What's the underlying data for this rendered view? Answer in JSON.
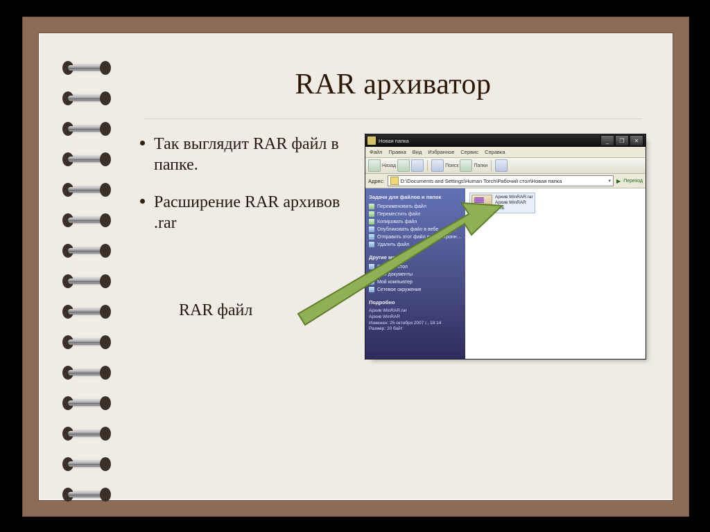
{
  "slide": {
    "title": "RAR архиватор",
    "bullets": [
      "Так выглядит RAR файл в папке.",
      "Расширение RAR архивов .rar"
    ],
    "caption": "RAR файл"
  },
  "window": {
    "title": "Новая папка",
    "controls": {
      "min": "_",
      "max": "❐",
      "close": "✕"
    },
    "menu": [
      "Файл",
      "Правка",
      "Вид",
      "Избранное",
      "Сервис",
      "Справка"
    ],
    "toolbar": {
      "back": "Назад",
      "search": "Поиск",
      "folders": "Папки"
    },
    "address": {
      "label": "Адрес:",
      "path": "D:\\Documents and Settings\\Human Torch\\Рабочий стол\\Новая папка",
      "go": "Переход"
    },
    "pane": {
      "tasks_header": "Задачи для файлов и папок",
      "tasks": [
        "Переименовать файл",
        "Переместить файл",
        "Копировать файл",
        "Опубликовать файл в вебе",
        "Отправить этот файл по электронной почте",
        "Удалить файл"
      ],
      "places_header": "Другие места",
      "places": [
        "Рабочий стол",
        "Мои документы",
        "Мой компьютер",
        "Сетевое окружение"
      ],
      "details_header": "Подробно",
      "details": {
        "name": "Архив WinRAR.rar",
        "type": "Архив WinRAR",
        "modified": "Изменен: 25 октября 2007 г., 18:14",
        "size": "Размер: 20 байт"
      }
    },
    "file": {
      "name": "Архив WinRAR.rar",
      "type": "Архив WinRAR",
      "size": "1 КБ"
    }
  },
  "appearance": {
    "frame_color": "#8c6b57",
    "slide_bg": "#eeece4",
    "arrow_color": "#8fb055"
  }
}
